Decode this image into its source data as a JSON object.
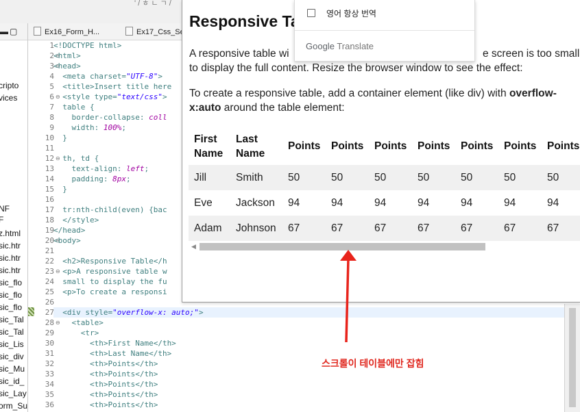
{
  "ide": {
    "top_partial_text": "' / ㅎ ㄴ ㄱ /",
    "left_panel_items": [
      "cripto",
      "vices",
      "NF",
      "F",
      "z.html",
      "sic.htr",
      "sic.htr",
      "sic.htr",
      "sic_flo",
      "sic_flo",
      "sic_flo",
      "sic_Tal",
      "sic_Tal",
      "sic_Lis",
      "sic_div",
      "sic_Mu",
      "sic_id_",
      "sic_Lay",
      "orm_Su"
    ],
    "tabs": [
      "Ex16_Form_H...",
      "Ex17_Css_Se"
    ],
    "line_numbers": [
      "1",
      "2",
      "3",
      "4",
      "5",
      "6",
      "7",
      "8",
      "9",
      "10",
      "11",
      "12",
      "13",
      "14",
      "15",
      "16",
      "17",
      "18",
      "19",
      "20",
      "21",
      "22",
      "23",
      "24",
      "25",
      "26",
      "27",
      "28",
      "29",
      "30",
      "31",
      "32",
      "33",
      "34",
      "35",
      "36"
    ],
    "code_lines": [
      "<!DOCTYPE html>",
      "<html>",
      "<head>",
      "  <meta charset=\"UTF-8\">",
      "  <title>Insert title here",
      "  <style type=\"text/css\">",
      "  table {",
      "    border-collapse: coll",
      "    width: 100%;",
      "  }",
      "",
      "  th, td {",
      "    text-align: left;",
      "    padding: 8px;",
      "  }",
      "",
      "  tr:nth-child(even) {bac",
      "  </style>",
      "</head>",
      "<body>",
      "",
      "  <h2>Responsive Table</h",
      "  <p>A responsive table w",
      "  small to display the fu",
      "  <p>To create a responsi",
      "",
      "  <div style=\"overflow-x: auto;\">",
      "    <table>",
      "      <tr>",
      "        <th>First Name</th>",
      "        <th>Last Name</th>",
      "        <th>Points</th>",
      "        <th>Points</th>",
      "        <th>Points</th>",
      "        <th>Points</th>",
      "        <th>Points</th>"
    ]
  },
  "browser": {
    "heading": "Responsive Ta",
    "para1_line1": "A responsive table wi",
    "para1_line1_right": "e screen is too small",
    "para1_line2": "to display the full content. Resize the browser window to see the effect:",
    "para2_line1": "To create a responsive table, add a container element (like div) with ",
    "para2_bold1": "overflow-",
    "para2_bold2": "x:auto",
    "para2_line2_rest": " around the table element:",
    "table": {
      "headers": [
        "First Name",
        "Last Name",
        "Points",
        "Points",
        "Points",
        "Points",
        "Points",
        "Points",
        "Points"
      ],
      "rows": [
        [
          "Jill",
          "Smith",
          "50",
          "50",
          "50",
          "50",
          "50",
          "50",
          "50"
        ],
        [
          "Eve",
          "Jackson",
          "94",
          "94",
          "94",
          "94",
          "94",
          "94",
          "94"
        ],
        [
          "Adam",
          "Johnson",
          "67",
          "67",
          "67",
          "67",
          "67",
          "67",
          "67"
        ]
      ]
    }
  },
  "translate_menu": {
    "option": "영어 항상 번역",
    "brand_google": "Google",
    "brand_translate": "Translate"
  },
  "annotation": {
    "text": "스크롤이 테이블에만 잡힘",
    "color": "#e0281f"
  }
}
